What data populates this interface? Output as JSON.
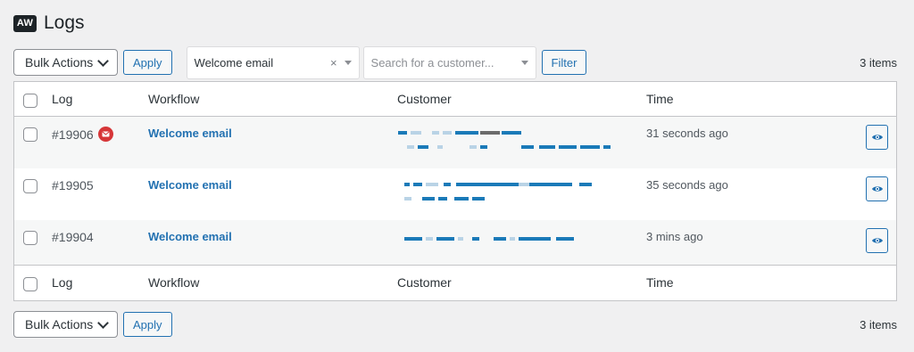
{
  "header": {
    "logo": "AW",
    "title": "Logs"
  },
  "toolbar": {
    "bulk_actions": "Bulk Actions",
    "apply": "Apply",
    "workflow_filter": {
      "value": "Welcome email",
      "clear": "×"
    },
    "customer_filter": {
      "placeholder": "Search for a customer..."
    },
    "filter": "Filter",
    "items_count": "3 items"
  },
  "table": {
    "columns": {
      "log": "Log",
      "workflow": "Workflow",
      "customer": "Customer",
      "time": "Time"
    },
    "rows": [
      {
        "id": "#19906",
        "workflow": "Welcome email",
        "time": "31 seconds ago",
        "has_email_icon": true
      },
      {
        "id": "#19905",
        "workflow": "Welcome email",
        "time": "35 seconds ago",
        "has_email_icon": false
      },
      {
        "id": "#19904",
        "workflow": "Welcome email",
        "time": "3 mins ago",
        "has_email_icon": false
      }
    ]
  },
  "bottom_toolbar": {
    "bulk_actions": "Bulk Actions",
    "apply": "Apply",
    "items_count": "3 items"
  },
  "icons": {
    "mail": "envelope-icon",
    "view": "eye-icon",
    "dropdown": "chevron-down-icon"
  },
  "colors": {
    "accent": "#2271b1",
    "email_badge": "#d63638"
  }
}
